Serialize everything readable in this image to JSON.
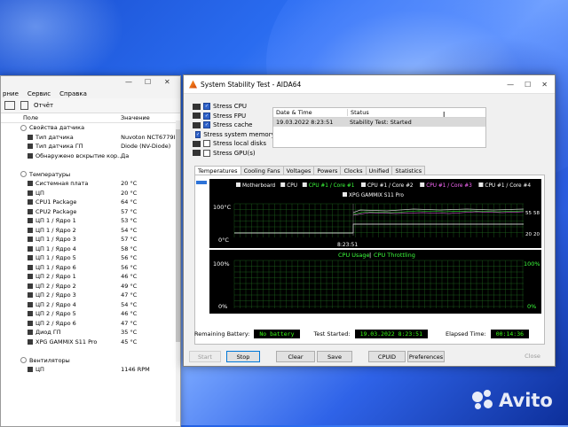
{
  "sensor_window": {
    "menu": [
      "рние",
      "Сервис",
      "Справка"
    ],
    "toolbar_report": "Отчёт",
    "col_field": "Поле",
    "col_value": "Значение",
    "rows": [
      {
        "kind": "group",
        "name": "Свойства датчика",
        "value": ""
      },
      {
        "kind": "item",
        "name": "Тип датчика",
        "value": "Nuvoton NCT6779I"
      },
      {
        "kind": "item",
        "name": "Тип датчика ГП",
        "value": "Diode  (NV-Diode)"
      },
      {
        "kind": "item",
        "name": "Обнаружено вскрытие кор...",
        "value": "Да"
      },
      {
        "kind": "spacer",
        "name": "",
        "value": ""
      },
      {
        "kind": "group",
        "name": "Температуры",
        "value": ""
      },
      {
        "kind": "item",
        "name": "Системная плата",
        "value": "20 °C"
      },
      {
        "kind": "item",
        "name": "ЦП",
        "value": "20 °C"
      },
      {
        "kind": "item",
        "name": "CPU1 Package",
        "value": "64 °C"
      },
      {
        "kind": "item",
        "name": "CPU2 Package",
        "value": "57 °C"
      },
      {
        "kind": "item",
        "name": "ЦП 1 / Ядро 1",
        "value": "53 °C"
      },
      {
        "kind": "item",
        "name": "ЦП 1 / Ядро 2",
        "value": "54 °C"
      },
      {
        "kind": "item",
        "name": "ЦП 1 / Ядро 3",
        "value": "57 °C"
      },
      {
        "kind": "item",
        "name": "ЦП 1 / Ядро 4",
        "value": "58 °C"
      },
      {
        "kind": "item",
        "name": "ЦП 1 / Ядро 5",
        "value": "56 °C"
      },
      {
        "kind": "item",
        "name": "ЦП 1 / Ядро 6",
        "value": "56 °C"
      },
      {
        "kind": "item",
        "name": "ЦП 2 / Ядро 1",
        "value": "46 °C"
      },
      {
        "kind": "item",
        "name": "ЦП 2 / Ядро 2",
        "value": "49 °C"
      },
      {
        "kind": "item",
        "name": "ЦП 2 / Ядро 3",
        "value": "47 °C"
      },
      {
        "kind": "item",
        "name": "ЦП 2 / Ядро 4",
        "value": "54 °C"
      },
      {
        "kind": "item",
        "name": "ЦП 2 / Ядро 5",
        "value": "46 °C"
      },
      {
        "kind": "item",
        "name": "ЦП 2 / Ядро 6",
        "value": "47 °C"
      },
      {
        "kind": "item",
        "name": "Диод ГП",
        "value": "35 °C"
      },
      {
        "kind": "item",
        "name": "XPG GAMMIX S11 Pro",
        "value": "45 °C"
      },
      {
        "kind": "spacer",
        "name": "",
        "value": ""
      },
      {
        "kind": "group",
        "name": "Вентиляторы",
        "value": ""
      },
      {
        "kind": "item",
        "name": "ЦП",
        "value": "1146 RPM"
      }
    ]
  },
  "aida": {
    "title": "System Stability Test - AIDA64",
    "stress_options": [
      {
        "label": "Stress CPU",
        "checked": true
      },
      {
        "label": "Stress FPU",
        "checked": true
      },
      {
        "label": "Stress cache",
        "checked": true
      },
      {
        "label": "Stress system memory",
        "checked": true
      },
      {
        "label": "Stress local disks",
        "checked": false
      },
      {
        "label": "Stress GPU(s)",
        "checked": false
      }
    ],
    "log_headers": {
      "date": "Date & Time",
      "status": "Status"
    },
    "log_rows": [
      {
        "date": "19.03.2022 8:23:51",
        "status": "Stability Test: Started"
      }
    ],
    "tabs": [
      "Temperatures",
      "Cooling Fans",
      "Voltages",
      "Powers",
      "Clocks",
      "Unified",
      "Statistics"
    ],
    "legend": [
      {
        "label": "Motherboard",
        "color": "#ffffff"
      },
      {
        "label": "CPU",
        "color": "#ffffff"
      },
      {
        "label": "CPU #1 / Core #1",
        "color": "#3cff3c"
      },
      {
        "label": "CPU #1 / Core #2",
        "color": "#ffffff"
      },
      {
        "label": "CPU #1 / Core #3",
        "color": "#ff6bff"
      },
      {
        "label": "CPU #1 / Core #4",
        "color": "#ffffff"
      },
      {
        "label": "XPG GAMMIX S11 Pro",
        "color": "#ffffff"
      }
    ],
    "temp_graph": {
      "ymax": "100°C",
      "ymin": "0°C",
      "xlabel": "8:23:51",
      "right_top": "55",
      "right_top2": "58",
      "right_bot": "20",
      "right_bot2": "20"
    },
    "usage_graph": {
      "title_usage": "CPU Usage",
      "sep": "|",
      "title_throttle": "CPU Throttling",
      "ymax": "100%",
      "ymin": "0%",
      "right_max": "100%",
      "right_min": "0%"
    },
    "status": {
      "battery_label": "Remaining Battery:",
      "battery_value": "No battery",
      "started_label": "Test Started:",
      "started_value": "19.03.2022 8:23:51",
      "elapsed_label": "Elapsed Time:",
      "elapsed_value": "00:14:36"
    },
    "buttons": {
      "start": "Start",
      "stop": "Stop",
      "clear": "Clear",
      "save": "Save",
      "cpuid": "CPUID",
      "preferences": "Preferences",
      "close": "Close"
    }
  },
  "watermark": "Avito"
}
